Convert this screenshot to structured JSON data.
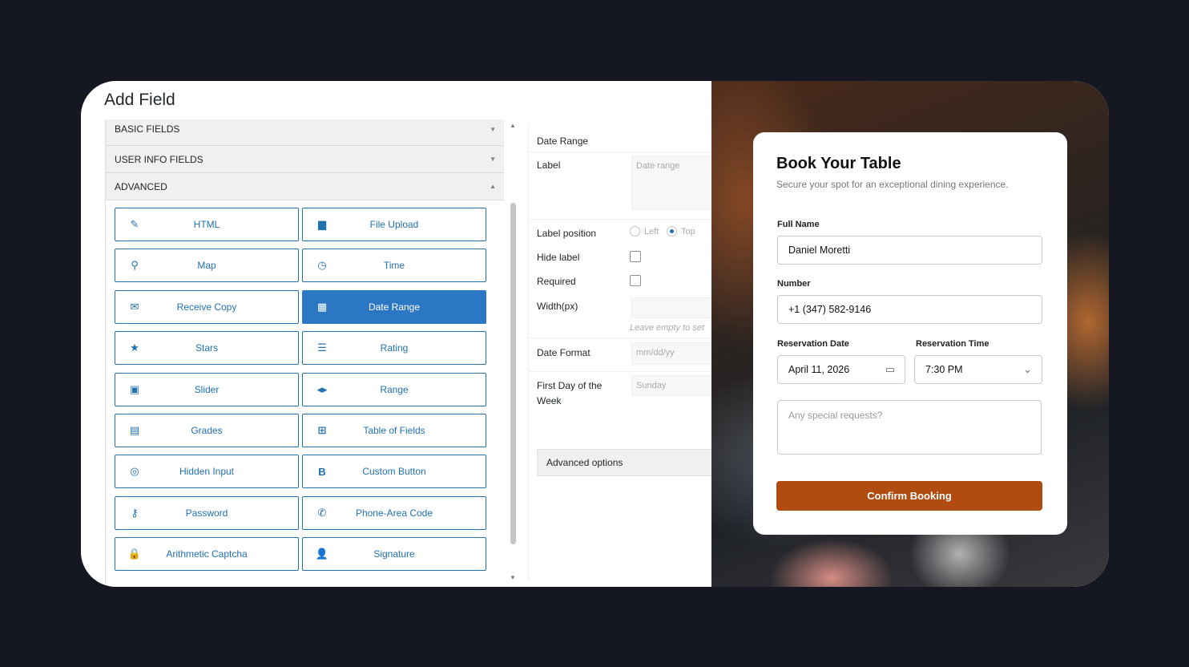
{
  "builder": {
    "title": "Add Field",
    "sections": [
      {
        "label": "BASIC FIELDS",
        "state": "collapsed"
      },
      {
        "label": "USER INFO FIELDS",
        "state": "collapsed"
      },
      {
        "label": "ADVANCED",
        "state": "expanded"
      }
    ],
    "fields": [
      {
        "label": "HTML",
        "icon": "pencil-icon",
        "glyph": "✎"
      },
      {
        "label": "File Upload",
        "icon": "folder-icon",
        "glyph": "▆"
      },
      {
        "label": "Map",
        "icon": "map-pin-icon",
        "glyph": "⚲"
      },
      {
        "label": "Time",
        "icon": "clock-icon",
        "glyph": "◷"
      },
      {
        "label": "Receive Copy",
        "icon": "envelope-icon",
        "glyph": "✉"
      },
      {
        "label": "Date Range",
        "icon": "calendar-icon",
        "glyph": "▦"
      },
      {
        "label": "Stars",
        "icon": "star-icon",
        "glyph": "★"
      },
      {
        "label": "Rating",
        "icon": "list-icon",
        "glyph": "☰"
      },
      {
        "label": "Slider",
        "icon": "slider-icon",
        "glyph": "▣"
      },
      {
        "label": "Range",
        "icon": "range-arrows-icon",
        "glyph": "◂▸"
      },
      {
        "label": "Grades",
        "icon": "grades-icon",
        "glyph": "▤"
      },
      {
        "label": "Table of Fields",
        "icon": "table-icon",
        "glyph": "⊞"
      },
      {
        "label": "Hidden Input",
        "icon": "eye-slash-icon",
        "glyph": "◎"
      },
      {
        "label": "Custom Button",
        "icon": "bold-b-icon",
        "glyph": "B"
      },
      {
        "label": "Password",
        "icon": "key-icon",
        "glyph": "⚷"
      },
      {
        "label": "Phone-Area Code",
        "icon": "phone-icon",
        "glyph": "✆"
      },
      {
        "label": "Arithmetic Captcha",
        "icon": "lock-icon",
        "glyph": "🔒"
      },
      {
        "label": "Signature",
        "icon": "user-icon",
        "glyph": "👤"
      }
    ],
    "active_field": "Date Range",
    "options": {
      "heading": "Date Range",
      "label_title": "Label",
      "label_placeholder": "Date range",
      "label_position_title": "Label position",
      "position_left": "Left",
      "position_top": "Top",
      "position_selected": "Top",
      "hide_label_title": "Hide label",
      "required_title": "Required",
      "width_title": "Width(px)",
      "width_help": "Leave empty to set",
      "date_format_title": "Date Format",
      "date_format_placeholder": "mm/dd/yy",
      "first_day_title_line1": "First Day of the",
      "first_day_title_line2": "Week",
      "first_day_value": "Sunday",
      "advanced_options": "Advanced options"
    }
  },
  "booking": {
    "title": "Book Your Table",
    "subtitle": "Secure your spot for an exceptional dining experience.",
    "full_name_label": "Full Name",
    "full_name_value": "Daniel Moretti",
    "number_label": "Number",
    "number_value": "+1 (347) 582-9146",
    "date_label": "Reservation Date",
    "date_value": "April 11, 2026",
    "time_label": "Reservation Time",
    "time_value": "7:30 PM",
    "requests_placeholder": "Any special requests?",
    "confirm_label": "Confirm Booking",
    "accent_color": "#b14b0f"
  }
}
